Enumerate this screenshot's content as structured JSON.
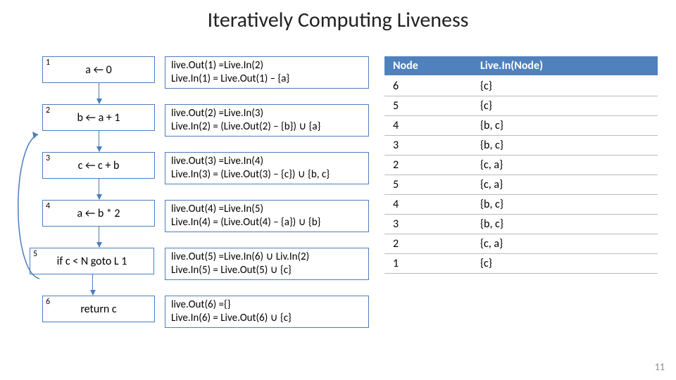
{
  "title": "Iteratively Computing Liveness",
  "cfg": {
    "nodes": [
      {
        "num": "1",
        "code": "a ← 0"
      },
      {
        "num": "2",
        "code": "b ← a + 1"
      },
      {
        "num": "3",
        "code": "c ← c + b"
      },
      {
        "num": "4",
        "code": "a ← b * 2"
      },
      {
        "num": "5",
        "code": "if c < N goto L 1"
      },
      {
        "num": "6",
        "code": "return c"
      }
    ]
  },
  "equations": [
    {
      "out": "live.Out(1) =Live.In(2)",
      "in": "Live.In(1) = Live.Out(1) – {a}"
    },
    {
      "out": "live.Out(2) =Live.In(3)",
      "in": "Live.In(2) = (Live.Out(2) – {b}) ∪ {a}"
    },
    {
      "out": "live.Out(3) =Live.In(4)",
      "in": "Live.In(3) = (Live.Out(3) – {c}) ∪ {b, c}"
    },
    {
      "out": "live.Out(4) =Live.In(5)",
      "in": "Live.In(4) = (Live.Out(4) – {a}) ∪ {b}"
    },
    {
      "out": "live.Out(5) =Live.In(6) ∪ Liv.In(2)",
      "in": "Live.In(5) = Live.Out(5) ∪ {c}"
    },
    {
      "out": "live.Out(6) ={}",
      "in": "Live.In(6) = Live.Out(6) ∪ {c}"
    }
  ],
  "table": {
    "headers": [
      "Node",
      "Live.In(Node)"
    ],
    "rows": [
      [
        "6",
        "{c}"
      ],
      [
        "5",
        "{c}"
      ],
      [
        "4",
        "{b, c}"
      ],
      [
        "3",
        "{b, c}"
      ],
      [
        "2",
        "{c, a}"
      ],
      [
        "5",
        "{c, a}"
      ],
      [
        "4",
        "{b, c}"
      ],
      [
        "3",
        "{b, c}"
      ],
      [
        "2",
        "{c, a}"
      ],
      [
        "1",
        "{c}"
      ]
    ]
  },
  "page_number": "11"
}
